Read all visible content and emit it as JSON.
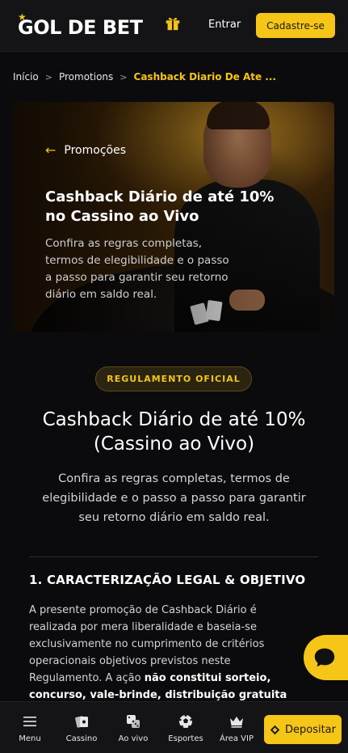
{
  "header": {
    "logo_text": "GOL DE BET",
    "login_label": "Entrar",
    "signup_label": "Cadastre-se"
  },
  "breadcrumb": {
    "items": [
      "Início",
      "Promotions",
      "Cashback Diario De Ate ..."
    ],
    "separator": ">"
  },
  "hero": {
    "back_label": "Promoções",
    "title": "Cashback Diário de até 10% no Cassino ao Vivo",
    "description": "Confira as regras completas, termos de elegibilidade e o passo a passo para garantir seu retorno diário em saldo real."
  },
  "content": {
    "badge": "REGULAMENTO OFICIAL",
    "title": "Cashback Diário de até 10% (Cassino ao Vivo)",
    "description": "Confira as regras completas, termos de elegibilidade e o passo a passo para garantir seu retorno diário em saldo real.",
    "section1_title": "1. CARACTERIZAÇÃO LEGAL & OBJETIVO",
    "section1_text": "A presente promoção de Cashback Diário é realizada por mera liberalidade e baseia-se exclusivamente no cumprimento de critérios operacionais objetivos previstos neste Regulamento. A ação ",
    "section1_bold": "não constitui sorteio, concurso, vale-brinde, distribuição gratuita autônoma de prêmios ou captação antecipada de"
  },
  "bottom_nav": {
    "items": [
      "Menu",
      "Cassino",
      "Ao vivo",
      "Esportes",
      "Área VIP"
    ],
    "deposit_label": "Depositar"
  },
  "colors": {
    "accent": "#f5c518",
    "background": "#0b0b0d",
    "header_bg": "#141417"
  },
  "icons": {
    "gift": "gift-icon",
    "back": "arrow-left-icon",
    "chat": "chat-bubble-icon",
    "menu": "hamburger-icon",
    "casino": "cards-icon",
    "live": "dice-icon",
    "sports": "soccer-ball-icon",
    "vip": "crown-icon",
    "deposit": "diamond-icon"
  }
}
